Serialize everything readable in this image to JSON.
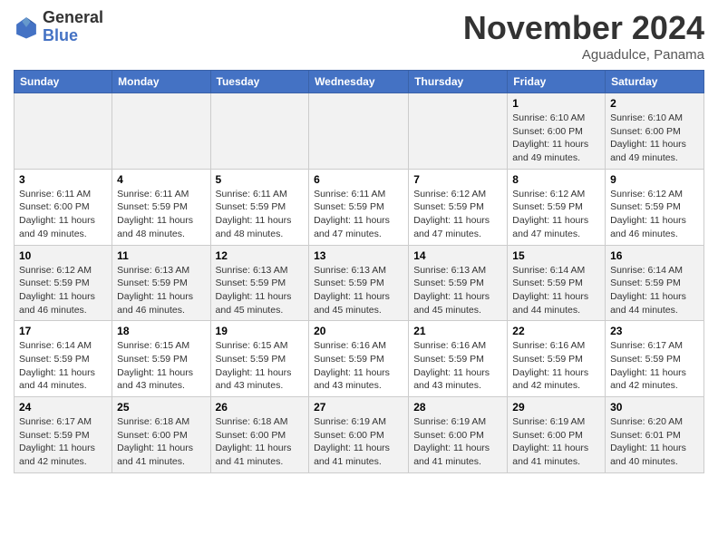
{
  "header": {
    "logo": {
      "general": "General",
      "blue": "Blue"
    },
    "title": "November 2024",
    "location": "Aguadulce, Panama"
  },
  "days_of_week": [
    "Sunday",
    "Monday",
    "Tuesday",
    "Wednesday",
    "Thursday",
    "Friday",
    "Saturday"
  ],
  "weeks": [
    [
      {
        "day": "",
        "info": ""
      },
      {
        "day": "",
        "info": ""
      },
      {
        "day": "",
        "info": ""
      },
      {
        "day": "",
        "info": ""
      },
      {
        "day": "",
        "info": ""
      },
      {
        "day": "1",
        "info": "Sunrise: 6:10 AM\nSunset: 6:00 PM\nDaylight: 11 hours and 49 minutes."
      },
      {
        "day": "2",
        "info": "Sunrise: 6:10 AM\nSunset: 6:00 PM\nDaylight: 11 hours and 49 minutes."
      }
    ],
    [
      {
        "day": "3",
        "info": "Sunrise: 6:11 AM\nSunset: 6:00 PM\nDaylight: 11 hours and 49 minutes."
      },
      {
        "day": "4",
        "info": "Sunrise: 6:11 AM\nSunset: 5:59 PM\nDaylight: 11 hours and 48 minutes."
      },
      {
        "day": "5",
        "info": "Sunrise: 6:11 AM\nSunset: 5:59 PM\nDaylight: 11 hours and 48 minutes."
      },
      {
        "day": "6",
        "info": "Sunrise: 6:11 AM\nSunset: 5:59 PM\nDaylight: 11 hours and 47 minutes."
      },
      {
        "day": "7",
        "info": "Sunrise: 6:12 AM\nSunset: 5:59 PM\nDaylight: 11 hours and 47 minutes."
      },
      {
        "day": "8",
        "info": "Sunrise: 6:12 AM\nSunset: 5:59 PM\nDaylight: 11 hours and 47 minutes."
      },
      {
        "day": "9",
        "info": "Sunrise: 6:12 AM\nSunset: 5:59 PM\nDaylight: 11 hours and 46 minutes."
      }
    ],
    [
      {
        "day": "10",
        "info": "Sunrise: 6:12 AM\nSunset: 5:59 PM\nDaylight: 11 hours and 46 minutes."
      },
      {
        "day": "11",
        "info": "Sunrise: 6:13 AM\nSunset: 5:59 PM\nDaylight: 11 hours and 46 minutes."
      },
      {
        "day": "12",
        "info": "Sunrise: 6:13 AM\nSunset: 5:59 PM\nDaylight: 11 hours and 45 minutes."
      },
      {
        "day": "13",
        "info": "Sunrise: 6:13 AM\nSunset: 5:59 PM\nDaylight: 11 hours and 45 minutes."
      },
      {
        "day": "14",
        "info": "Sunrise: 6:13 AM\nSunset: 5:59 PM\nDaylight: 11 hours and 45 minutes."
      },
      {
        "day": "15",
        "info": "Sunrise: 6:14 AM\nSunset: 5:59 PM\nDaylight: 11 hours and 44 minutes."
      },
      {
        "day": "16",
        "info": "Sunrise: 6:14 AM\nSunset: 5:59 PM\nDaylight: 11 hours and 44 minutes."
      }
    ],
    [
      {
        "day": "17",
        "info": "Sunrise: 6:14 AM\nSunset: 5:59 PM\nDaylight: 11 hours and 44 minutes."
      },
      {
        "day": "18",
        "info": "Sunrise: 6:15 AM\nSunset: 5:59 PM\nDaylight: 11 hours and 43 minutes."
      },
      {
        "day": "19",
        "info": "Sunrise: 6:15 AM\nSunset: 5:59 PM\nDaylight: 11 hours and 43 minutes."
      },
      {
        "day": "20",
        "info": "Sunrise: 6:16 AM\nSunset: 5:59 PM\nDaylight: 11 hours and 43 minutes."
      },
      {
        "day": "21",
        "info": "Sunrise: 6:16 AM\nSunset: 5:59 PM\nDaylight: 11 hours and 43 minutes."
      },
      {
        "day": "22",
        "info": "Sunrise: 6:16 AM\nSunset: 5:59 PM\nDaylight: 11 hours and 42 minutes."
      },
      {
        "day": "23",
        "info": "Sunrise: 6:17 AM\nSunset: 5:59 PM\nDaylight: 11 hours and 42 minutes."
      }
    ],
    [
      {
        "day": "24",
        "info": "Sunrise: 6:17 AM\nSunset: 5:59 PM\nDaylight: 11 hours and 42 minutes."
      },
      {
        "day": "25",
        "info": "Sunrise: 6:18 AM\nSunset: 6:00 PM\nDaylight: 11 hours and 41 minutes."
      },
      {
        "day": "26",
        "info": "Sunrise: 6:18 AM\nSunset: 6:00 PM\nDaylight: 11 hours and 41 minutes."
      },
      {
        "day": "27",
        "info": "Sunrise: 6:19 AM\nSunset: 6:00 PM\nDaylight: 11 hours and 41 minutes."
      },
      {
        "day": "28",
        "info": "Sunrise: 6:19 AM\nSunset: 6:00 PM\nDaylight: 11 hours and 41 minutes."
      },
      {
        "day": "29",
        "info": "Sunrise: 6:19 AM\nSunset: 6:00 PM\nDaylight: 11 hours and 41 minutes."
      },
      {
        "day": "30",
        "info": "Sunrise: 6:20 AM\nSunset: 6:01 PM\nDaylight: 11 hours and 40 minutes."
      }
    ]
  ]
}
